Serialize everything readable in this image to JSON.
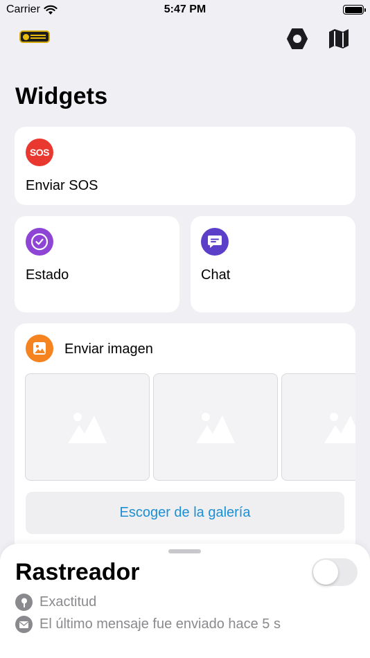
{
  "status_bar": {
    "carrier": "Carrier",
    "time": "5:47 PM"
  },
  "nav": {
    "logo": "app-logo",
    "settings_icon": "gear-icon",
    "map_icon": "map-icon"
  },
  "page_title": "Widgets",
  "widgets": {
    "sos": {
      "badge": "SOS",
      "label": "Enviar SOS",
      "color": "#e8382f"
    },
    "estado": {
      "label": "Estado",
      "color": "#8e44d4"
    },
    "chat": {
      "label": "Chat",
      "color": "#5b3fc8"
    },
    "image": {
      "label": "Enviar imagen",
      "color": "#f5831f",
      "gallery_button": "Escoger de la galería"
    }
  },
  "tracker": {
    "title": "Rastreador",
    "enabled": false,
    "accuracy_label": "Exactitud",
    "last_message": "El último mensaje fue enviado hace 5 s"
  }
}
